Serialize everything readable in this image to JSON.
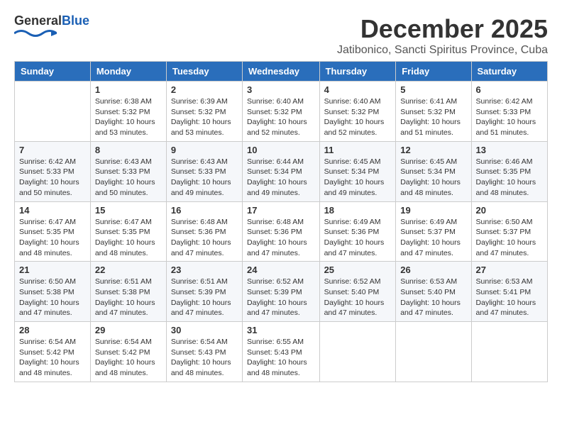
{
  "header": {
    "logo_general": "General",
    "logo_blue": "Blue",
    "month": "December 2025",
    "location": "Jatibonico, Sancti Spiritus Province, Cuba"
  },
  "weekdays": [
    "Sunday",
    "Monday",
    "Tuesday",
    "Wednesday",
    "Thursday",
    "Friday",
    "Saturday"
  ],
  "weeks": [
    [
      {
        "day": "",
        "info": ""
      },
      {
        "day": "1",
        "info": "Sunrise: 6:38 AM\nSunset: 5:32 PM\nDaylight: 10 hours\nand 53 minutes."
      },
      {
        "day": "2",
        "info": "Sunrise: 6:39 AM\nSunset: 5:32 PM\nDaylight: 10 hours\nand 53 minutes."
      },
      {
        "day": "3",
        "info": "Sunrise: 6:40 AM\nSunset: 5:32 PM\nDaylight: 10 hours\nand 52 minutes."
      },
      {
        "day": "4",
        "info": "Sunrise: 6:40 AM\nSunset: 5:32 PM\nDaylight: 10 hours\nand 52 minutes."
      },
      {
        "day": "5",
        "info": "Sunrise: 6:41 AM\nSunset: 5:32 PM\nDaylight: 10 hours\nand 51 minutes."
      },
      {
        "day": "6",
        "info": "Sunrise: 6:42 AM\nSunset: 5:33 PM\nDaylight: 10 hours\nand 51 minutes."
      }
    ],
    [
      {
        "day": "7",
        "info": "Sunrise: 6:42 AM\nSunset: 5:33 PM\nDaylight: 10 hours\nand 50 minutes."
      },
      {
        "day": "8",
        "info": "Sunrise: 6:43 AM\nSunset: 5:33 PM\nDaylight: 10 hours\nand 50 minutes."
      },
      {
        "day": "9",
        "info": "Sunrise: 6:43 AM\nSunset: 5:33 PM\nDaylight: 10 hours\nand 49 minutes."
      },
      {
        "day": "10",
        "info": "Sunrise: 6:44 AM\nSunset: 5:34 PM\nDaylight: 10 hours\nand 49 minutes."
      },
      {
        "day": "11",
        "info": "Sunrise: 6:45 AM\nSunset: 5:34 PM\nDaylight: 10 hours\nand 49 minutes."
      },
      {
        "day": "12",
        "info": "Sunrise: 6:45 AM\nSunset: 5:34 PM\nDaylight: 10 hours\nand 48 minutes."
      },
      {
        "day": "13",
        "info": "Sunrise: 6:46 AM\nSunset: 5:35 PM\nDaylight: 10 hours\nand 48 minutes."
      }
    ],
    [
      {
        "day": "14",
        "info": "Sunrise: 6:47 AM\nSunset: 5:35 PM\nDaylight: 10 hours\nand 48 minutes."
      },
      {
        "day": "15",
        "info": "Sunrise: 6:47 AM\nSunset: 5:35 PM\nDaylight: 10 hours\nand 48 minutes."
      },
      {
        "day": "16",
        "info": "Sunrise: 6:48 AM\nSunset: 5:36 PM\nDaylight: 10 hours\nand 47 minutes."
      },
      {
        "day": "17",
        "info": "Sunrise: 6:48 AM\nSunset: 5:36 PM\nDaylight: 10 hours\nand 47 minutes."
      },
      {
        "day": "18",
        "info": "Sunrise: 6:49 AM\nSunset: 5:36 PM\nDaylight: 10 hours\nand 47 minutes."
      },
      {
        "day": "19",
        "info": "Sunrise: 6:49 AM\nSunset: 5:37 PM\nDaylight: 10 hours\nand 47 minutes."
      },
      {
        "day": "20",
        "info": "Sunrise: 6:50 AM\nSunset: 5:37 PM\nDaylight: 10 hours\nand 47 minutes."
      }
    ],
    [
      {
        "day": "21",
        "info": "Sunrise: 6:50 AM\nSunset: 5:38 PM\nDaylight: 10 hours\nand 47 minutes."
      },
      {
        "day": "22",
        "info": "Sunrise: 6:51 AM\nSunset: 5:38 PM\nDaylight: 10 hours\nand 47 minutes."
      },
      {
        "day": "23",
        "info": "Sunrise: 6:51 AM\nSunset: 5:39 PM\nDaylight: 10 hours\nand 47 minutes."
      },
      {
        "day": "24",
        "info": "Sunrise: 6:52 AM\nSunset: 5:39 PM\nDaylight: 10 hours\nand 47 minutes."
      },
      {
        "day": "25",
        "info": "Sunrise: 6:52 AM\nSunset: 5:40 PM\nDaylight: 10 hours\nand 47 minutes."
      },
      {
        "day": "26",
        "info": "Sunrise: 6:53 AM\nSunset: 5:40 PM\nDaylight: 10 hours\nand 47 minutes."
      },
      {
        "day": "27",
        "info": "Sunrise: 6:53 AM\nSunset: 5:41 PM\nDaylight: 10 hours\nand 47 minutes."
      }
    ],
    [
      {
        "day": "28",
        "info": "Sunrise: 6:54 AM\nSunset: 5:42 PM\nDaylight: 10 hours\nand 48 minutes."
      },
      {
        "day": "29",
        "info": "Sunrise: 6:54 AM\nSunset: 5:42 PM\nDaylight: 10 hours\nand 48 minutes."
      },
      {
        "day": "30",
        "info": "Sunrise: 6:54 AM\nSunset: 5:43 PM\nDaylight: 10 hours\nand 48 minutes."
      },
      {
        "day": "31",
        "info": "Sunrise: 6:55 AM\nSunset: 5:43 PM\nDaylight: 10 hours\nand 48 minutes."
      },
      {
        "day": "",
        "info": ""
      },
      {
        "day": "",
        "info": ""
      },
      {
        "day": "",
        "info": ""
      }
    ]
  ]
}
